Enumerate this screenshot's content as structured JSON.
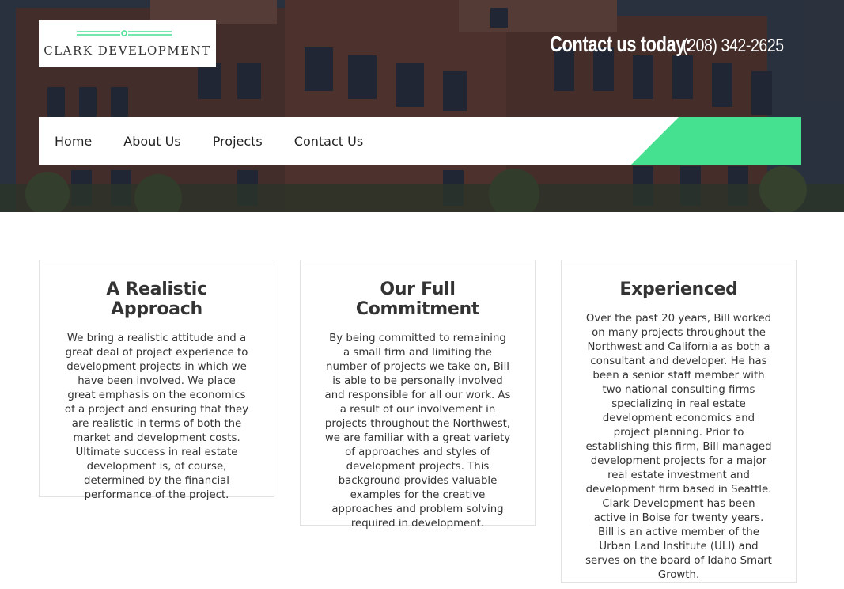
{
  "header": {
    "logo_text": "CLARK DEVELOPMENT",
    "contact_label": "Contact us today:",
    "contact_phone": "(208) 342-2625"
  },
  "nav": {
    "items": [
      {
        "label": "Home"
      },
      {
        "label": "About Us"
      },
      {
        "label": "Projects"
      },
      {
        "label": "Contact Us"
      }
    ],
    "accent_color": "#45e090"
  },
  "features": [
    {
      "title": "A Realistic Approach",
      "body": "We bring a realistic attitude and a great deal of project experience to development projects in which we have been involved. We place great emphasis on the economics of a project and ensuring that they are realistic in terms of both the market and development costs. Ultimate success in real estate development is, of course, determined by the financial performance of the project."
    },
    {
      "title": "Our Full Commitment",
      "body": "By being committed to remaining a small firm and limiting the number of projects we take on, Bill is able to be personally involved and responsible for all our work. As a result of our involvement in projects throughout the Northwest, we are familiar with a great variety of approaches and styles of development projects. This background provides valuable examples for the creative approaches and problem solving required in development."
    },
    {
      "title": "Experienced",
      "body": "Over the past 20 years, Bill worked on many projects throughout the Northwest and California as both a consultant and developer. He has been a senior staff member with two national consulting firms specializing in real estate development economics and project planning. Prior to establishing this firm, Bill managed development projects for a major real estate investment and development firm based in Seattle. Clark Development has been active in Boise for twenty years. Bill is an active member of the Urban Land Institute (ULI) and serves on the board of Idaho Smart Growth."
    }
  ]
}
